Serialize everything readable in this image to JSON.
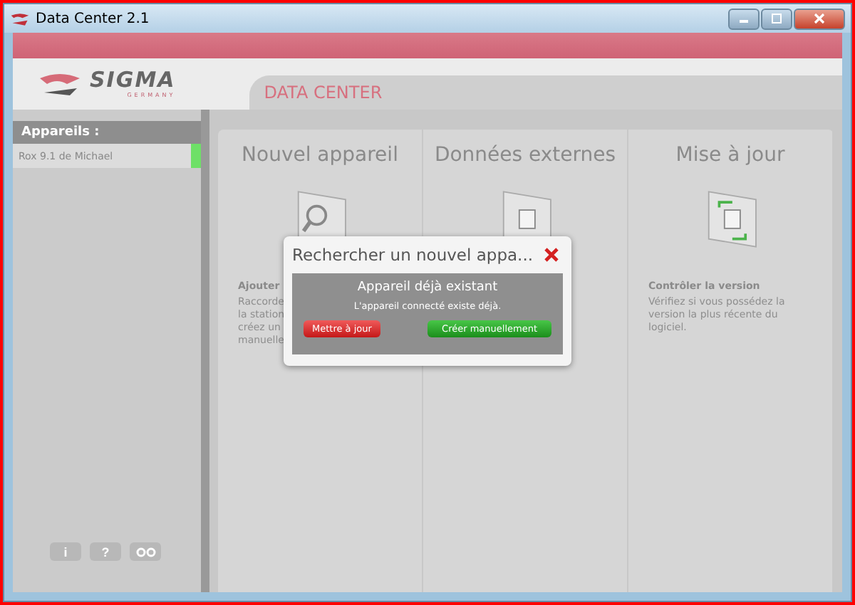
{
  "window": {
    "title": "Data Center 2.1"
  },
  "header": {
    "logo": "SIGMA",
    "logo_sub": "GERMANY",
    "app_title": "DATA CENTER"
  },
  "sidebar": {
    "heading": "Appareils :",
    "devices": [
      {
        "name": "Rox 9.1 de Michael",
        "connected": true
      }
    ],
    "buttons": [
      {
        "label": "i"
      },
      {
        "label": "?"
      }
    ]
  },
  "panels": [
    {
      "title": "Nouvel appareil",
      "heading": "Ajouter",
      "lines": [
        "Raccorde",
        "la station",
        "créez un",
        "manuelle"
      ]
    },
    {
      "title": "Données externes"
    },
    {
      "title": "Mise à jour",
      "heading": "Contrôler la version",
      "lines": [
        "Vérifiez si vous possédez la",
        "version la plus récente du",
        "logiciel."
      ]
    }
  ],
  "dialog": {
    "title": "Rechercher un nouvel appa...",
    "message_title": "Appareil déjà existant",
    "message": "L'appareil connecté existe déjà.",
    "buttons": [
      {
        "label": "Mettre à jour",
        "kind": "danger"
      },
      {
        "label": "Créer manuellement",
        "kind": "primary"
      }
    ]
  }
}
